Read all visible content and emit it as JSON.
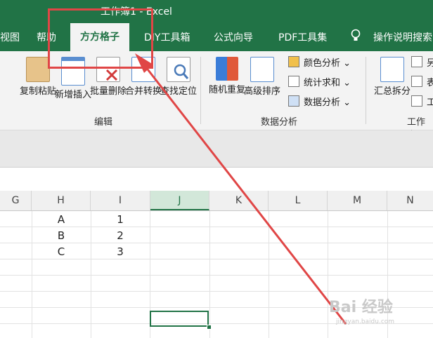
{
  "window": {
    "title": "工作簿1 - Excel"
  },
  "ribbon_tabs": [
    "视图",
    "帮助",
    "方方格子",
    "DIY工具箱",
    "公式向导",
    "PDF工具集",
    "操作说明搜索"
  ],
  "edit_group": {
    "label": "编辑",
    "buttons": [
      "复制粘贴",
      "新增插入",
      "批量删除",
      "合并转换",
      "查找定位"
    ]
  },
  "analysis_group": {
    "label": "数据分析",
    "buttons": [
      "随机重复",
      "高级排序"
    ],
    "small_items": [
      "颜色分析",
      "统计求和",
      "数据分析"
    ]
  },
  "worksheet_group": {
    "label": "工作表",
    "buttons": [
      "汇总拆分"
    ],
    "small_items": [
      "另",
      "表",
      "工"
    ]
  },
  "columns": [
    "G",
    "H",
    "I",
    "J",
    "K",
    "L",
    "M",
    "N"
  ],
  "selected_column": "J",
  "cells": {
    "H": [
      "A",
      "B",
      "C"
    ],
    "I": [
      "1",
      "2",
      "3"
    ]
  },
  "annotation": {
    "color": "#e04646"
  },
  "watermark": {
    "main": "Bai 经验",
    "sub": "jingyan.baidu.com"
  }
}
